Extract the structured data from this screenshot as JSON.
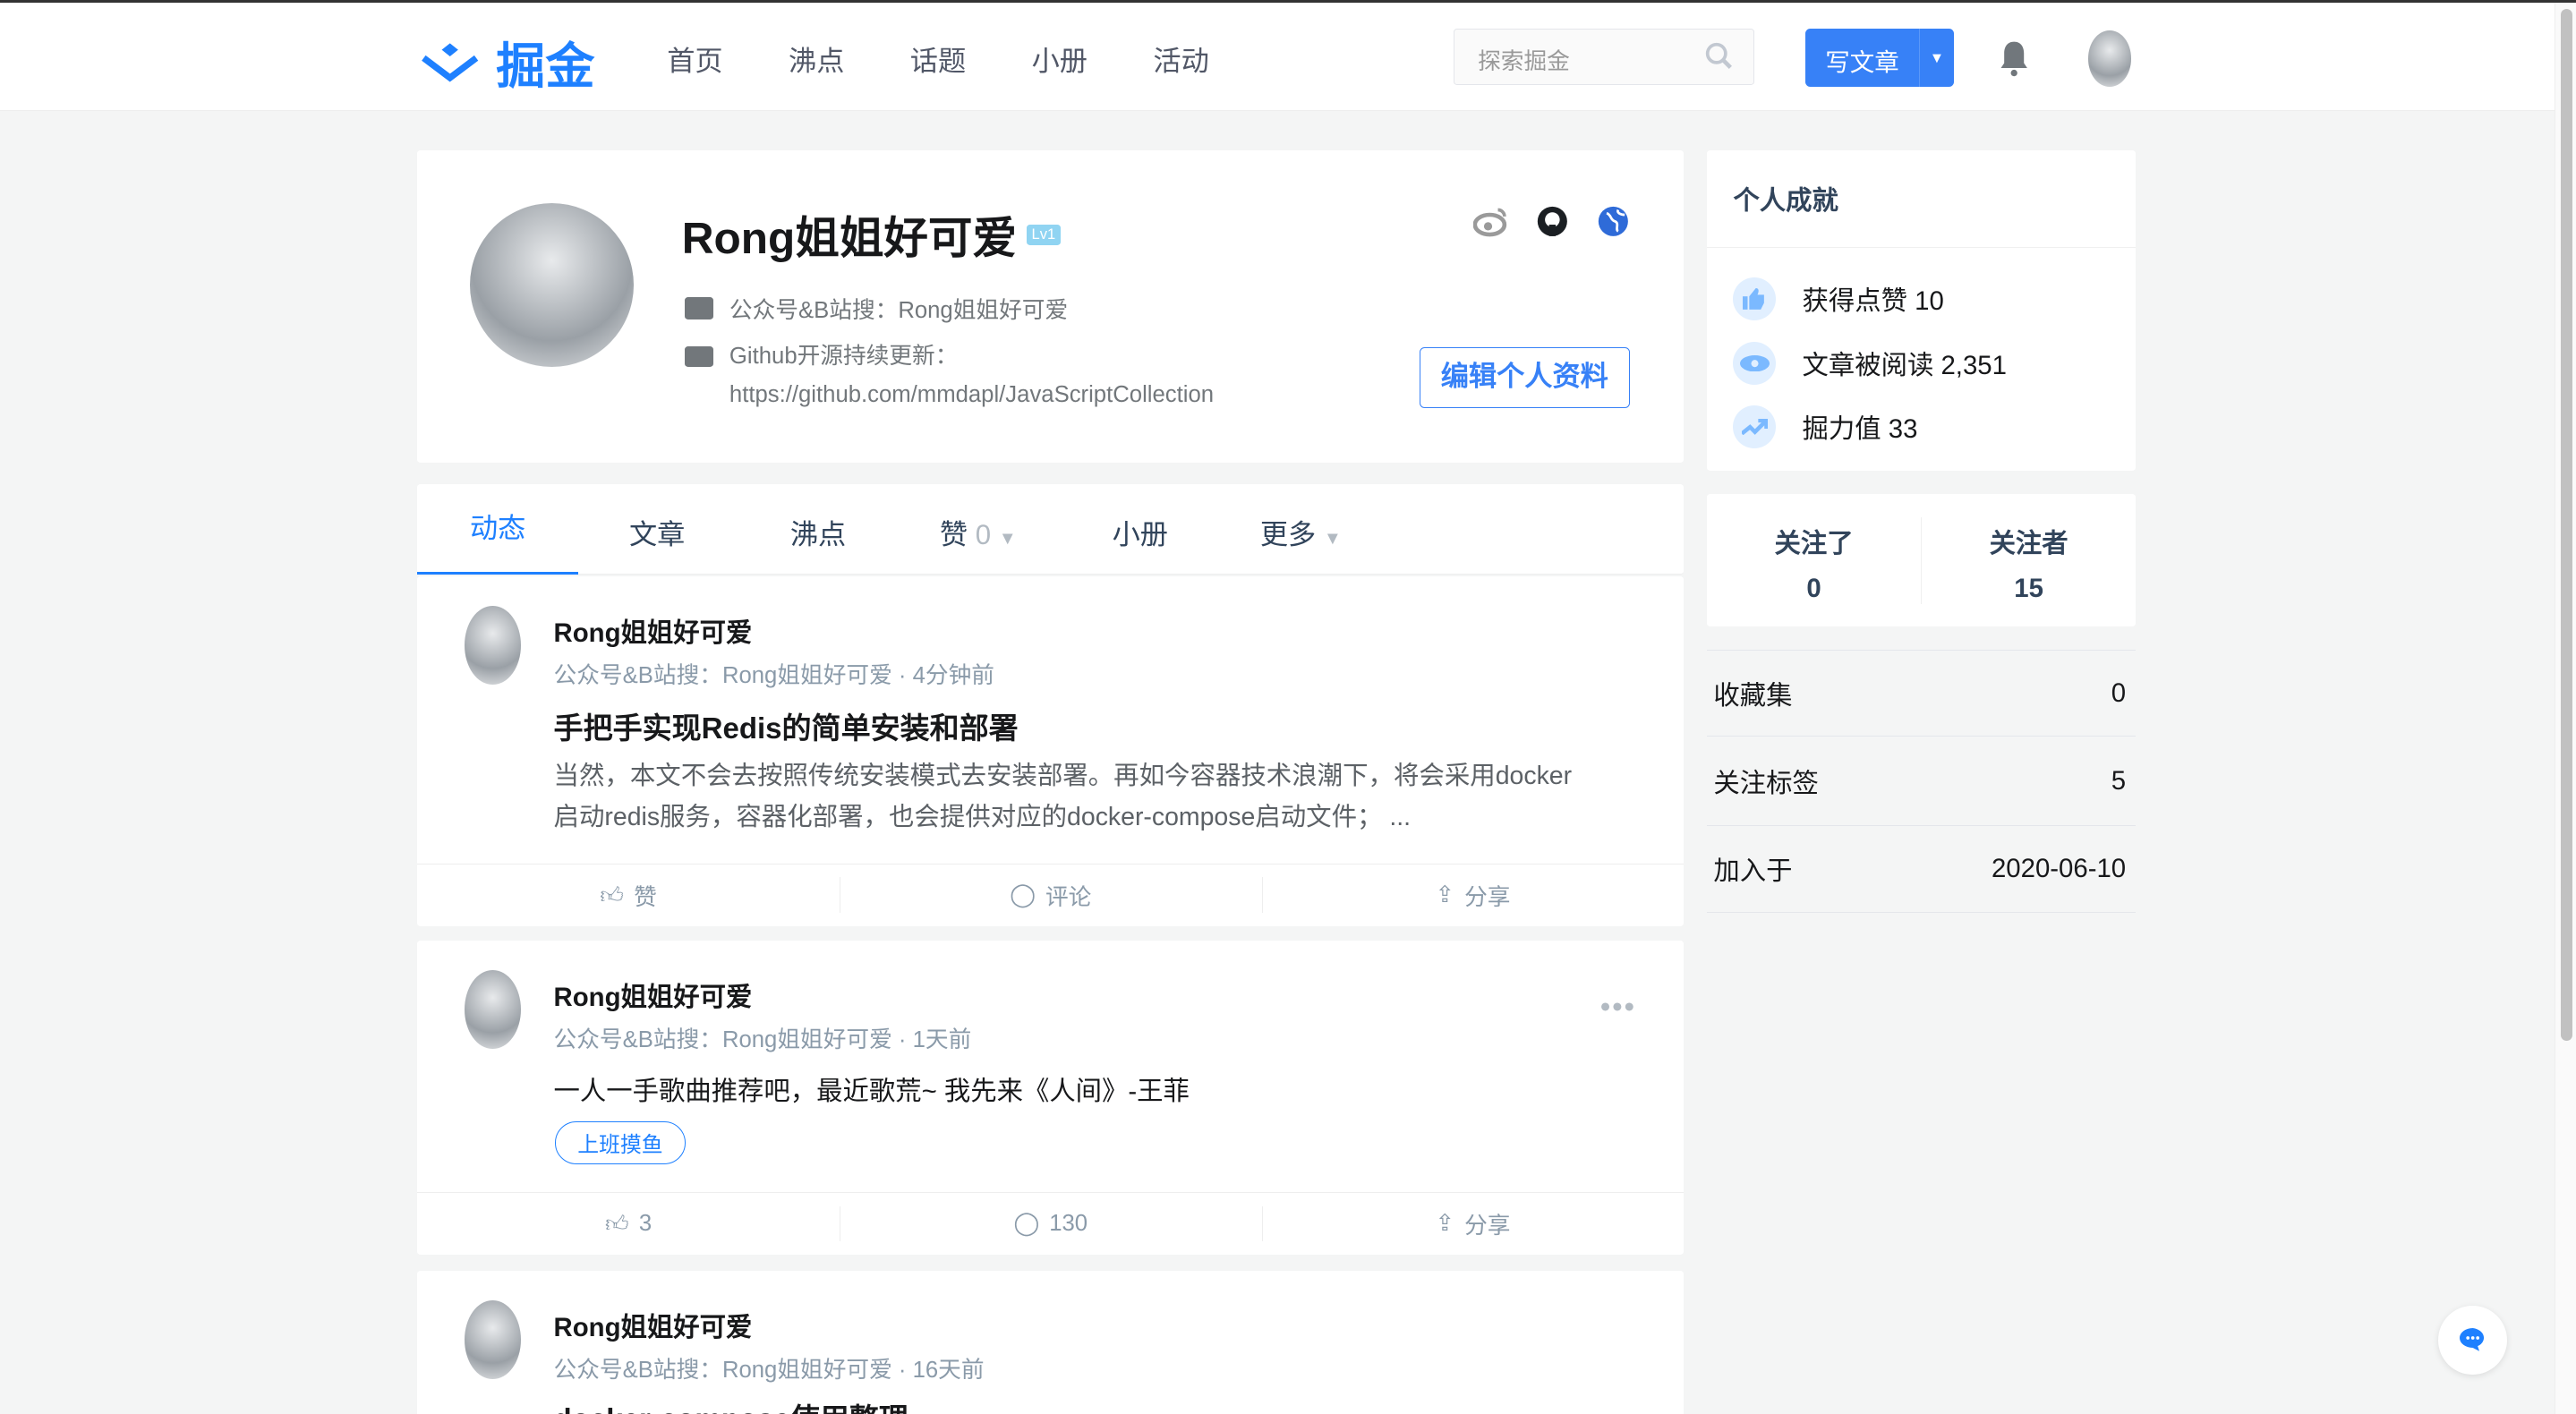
{
  "nav": {
    "logo_text": "掘金",
    "links": [
      "首页",
      "沸点",
      "话题",
      "小册",
      "活动"
    ],
    "search_placeholder": "探索掘金",
    "write_label": "写文章"
  },
  "profile": {
    "name": "Rong姐姐好可爱",
    "level": "Lv1",
    "job": "公众号&B站搜：Rong姐姐好可爱",
    "bio_line1": "Github开源持续更新：",
    "bio_line2": "https://github.com/mmdapl/JavaScriptCollection",
    "edit_label": "编辑个人资料"
  },
  "tabs": [
    {
      "label": "动态"
    },
    {
      "label": "文章"
    },
    {
      "label": "沸点"
    },
    {
      "label": "赞",
      "count": "0"
    },
    {
      "label": "小册"
    },
    {
      "label": "更多"
    }
  ],
  "feed": [
    {
      "author": "Rong姐姐好可爱",
      "meta": "公众号&B站搜：Rong姐姐好可爱 · 4分钟前",
      "title": "手把手实现Redis的简单安装和部署",
      "excerpt": "当然，本文不会去按照传统安装模式去安装部署。再如今容器技术浪潮下，将会采用docker启动redis服务，容器化部署，也会提供对应的docker-compose启动文件； ...",
      "like": "赞",
      "comment": "评论",
      "share": "分享"
    },
    {
      "author": "Rong姐姐好可爱",
      "meta": "公众号&B站搜：Rong姐姐好可爱 · 1天前",
      "content": "一人一手歌曲推荐吧，最近歌荒~ 我先来《人间》-王菲",
      "topic": "上班摸鱼",
      "like": "3",
      "comment": "130",
      "share": "分享"
    },
    {
      "author": "Rong姐姐好可爱",
      "meta": "公众号&B站搜：Rong姐姐好可爱 · 16天前",
      "title": "docker-compose使用整理"
    }
  ],
  "achievements": {
    "title": "个人成就",
    "likes": "获得点赞 10",
    "reads": "文章被阅读 2,351",
    "power": "掘力值 33"
  },
  "follow": {
    "following_label": "关注了",
    "following": "0",
    "followers_label": "关注者",
    "followers": "15"
  },
  "stats": [
    {
      "label": "收藏集",
      "value": "0"
    },
    {
      "label": "关注标签",
      "value": "5"
    },
    {
      "label": "加入于",
      "value": "2020-06-10"
    }
  ],
  "colors": {
    "accent": "#1e80ff",
    "background": "#f4f5f5"
  }
}
